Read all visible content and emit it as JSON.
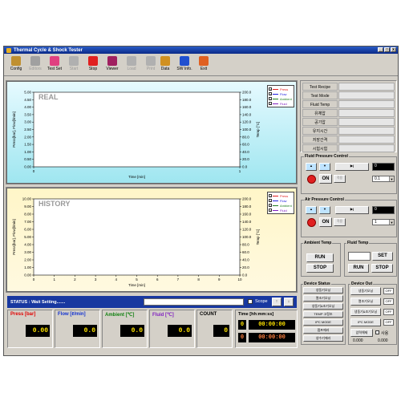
{
  "title": "Thermal Cycle & Shock Tester",
  "toolbar": [
    {
      "label": "Config",
      "icon": "config-icon",
      "enabled": true,
      "color": "#c09030"
    },
    {
      "label": "Editors",
      "icon": "editors-icon",
      "enabled": false,
      "color": "#a0a0a0"
    },
    {
      "label": "Test Set",
      "icon": "test-set-icon",
      "enabled": true,
      "color": "#e04080"
    },
    {
      "label": "Start",
      "icon": "start-icon",
      "enabled": false,
      "color": "#b0b0b0"
    },
    {
      "label": "Stop",
      "icon": "stop-icon",
      "enabled": true,
      "color": "#e02020"
    },
    {
      "label": "Viewer",
      "icon": "viewer-icon",
      "enabled": true,
      "color": "#a02060"
    },
    {
      "label": "Load",
      "icon": "load-icon",
      "enabled": false,
      "color": "#b0b0b0"
    },
    {
      "label": "Print",
      "icon": "print-icon",
      "enabled": false,
      "color": "#b0b0b0"
    },
    {
      "label": "Data",
      "icon": "data-icon",
      "enabled": true,
      "color": "#d09020"
    },
    {
      "label": "SW Info.",
      "icon": "info-icon",
      "enabled": true,
      "color": "#2050d0"
    },
    {
      "label": "Exit",
      "icon": "exit-icon",
      "enabled": true,
      "color": "#e06020"
    }
  ],
  "chart_data": [
    {
      "type": "line",
      "title": "REAL",
      "xlabel": "Time [min]",
      "ylabel": "Press[bar], Flow[l/min]",
      "y2label": "Temp [°C]",
      "xlim": [
        0,
        1
      ],
      "ylim": [
        0,
        5
      ],
      "y2lim": [
        0,
        200
      ],
      "xticks": [
        "0",
        "1"
      ],
      "yticks": [
        "0.00",
        "0.50",
        "1.00",
        "1.50",
        "2.00",
        "2.50",
        "3.00",
        "3.50",
        "4.00",
        "4.50",
        "5.00"
      ],
      "y2ticks": [
        "0.0",
        "20.0",
        "40.0",
        "60.0",
        "80.0",
        "100.0",
        "120.0",
        "140.0",
        "160.0",
        "180.0",
        "200.0"
      ],
      "grid": false,
      "legend_position": "top-right",
      "series": []
    },
    {
      "type": "line",
      "title": "HISTORY",
      "xlabel": "Time [min]",
      "ylabel": "Press[bar], Flow[l/min]",
      "y2label": "Temp [°C]",
      "xlim": [
        0,
        10
      ],
      "ylim": [
        0,
        10
      ],
      "y2lim": [
        0,
        200
      ],
      "xticks": [
        "0",
        "1",
        "2",
        "3",
        "4",
        "5",
        "6",
        "7",
        "8",
        "9",
        "10"
      ],
      "yticks": [
        "0.00",
        "1.00",
        "2.00",
        "3.00",
        "4.00",
        "5.00",
        "6.00",
        "7.00",
        "8.00",
        "9.00",
        "10.00"
      ],
      "y2ticks": [
        "0.0",
        "20.0",
        "40.0",
        "60.0",
        "80.0",
        "100.0",
        "120.0",
        "140.0",
        "160.0",
        "180.0",
        "200.0"
      ],
      "grid": false,
      "legend_position": "top-right",
      "series": []
    }
  ],
  "legend": [
    {
      "name": "Press",
      "color": "#e02020"
    },
    {
      "name": "Flow",
      "color": "#2020e0"
    },
    {
      "name": "Ambient",
      "color": "#208020"
    },
    {
      "name": "Fluid",
      "color": "#8020c0"
    }
  ],
  "status": {
    "text": "STATUS : Wait Setting.......",
    "scope_label": "Scope",
    "up": "↑",
    "down": "↓"
  },
  "readouts": [
    {
      "label": "Press [bar]",
      "value": "0.00",
      "color": "#e00000"
    },
    {
      "label": "Flow [ℓ/min]",
      "value": "0.0",
      "color": "#1030d0"
    },
    {
      "label": "Ambient [℃]",
      "value": "0.0",
      "color": "#108010"
    },
    {
      "label": "Fluid [℃]",
      "value": "0.0",
      "color": "#8020c0"
    },
    {
      "label": "COUNT",
      "value": "0",
      "color": "#000000"
    }
  ],
  "time": {
    "label": "Time [hh:mm:ss]",
    "rows": [
      {
        "n": "0",
        "t": "00:00:00"
      },
      {
        "n": "0",
        "t": "00:00:00"
      }
    ]
  },
  "info_labels": [
    "Test Recipe",
    "Test Mode",
    "Fluid Temp",
    "유체압",
    "공기압",
    "유지시간",
    "저장간격",
    "시험시험"
  ],
  "fluid_pressure": {
    "title": "Fluid Pressure Control",
    "value": "0",
    "on": "ON",
    "mode": "적용",
    "select": "0.1"
  },
  "air_pressure": {
    "title": "Air Pressure Control",
    "value": "0",
    "on": "ON",
    "mode": "적용",
    "select": "1"
  },
  "ambient": {
    "title": "Ambient Temp",
    "run": "RUN",
    "stop": "STOP"
  },
  "fluid_temp": {
    "title": "Fluid Temp",
    "set": "SET",
    "run": "RUN",
    "stop": "STOP"
  },
  "device_status": {
    "title": "Device Status",
    "items": [
      "냉동기오닝",
      "열조기오닝",
      "냉동기&조기오닝",
      "TEMP 고정조",
      "IPC MODE",
      "펌프에러",
      "냉수기에러"
    ]
  },
  "device_out": {
    "title": "Device Out",
    "items": [
      {
        "label": "냉동기오닝",
        "state": "OFF"
      },
      {
        "label": "열조기오닝",
        "state": "OFF"
      },
      {
        "label": "냉동기&조기오닝",
        "state": "OFF"
      },
      {
        "label": "IPC MODE",
        "state": "OFF"
      }
    ],
    "pressure_label": "압력해제",
    "pressure_check": "사용",
    "vals": [
      "0.000",
      "0.000"
    ]
  }
}
